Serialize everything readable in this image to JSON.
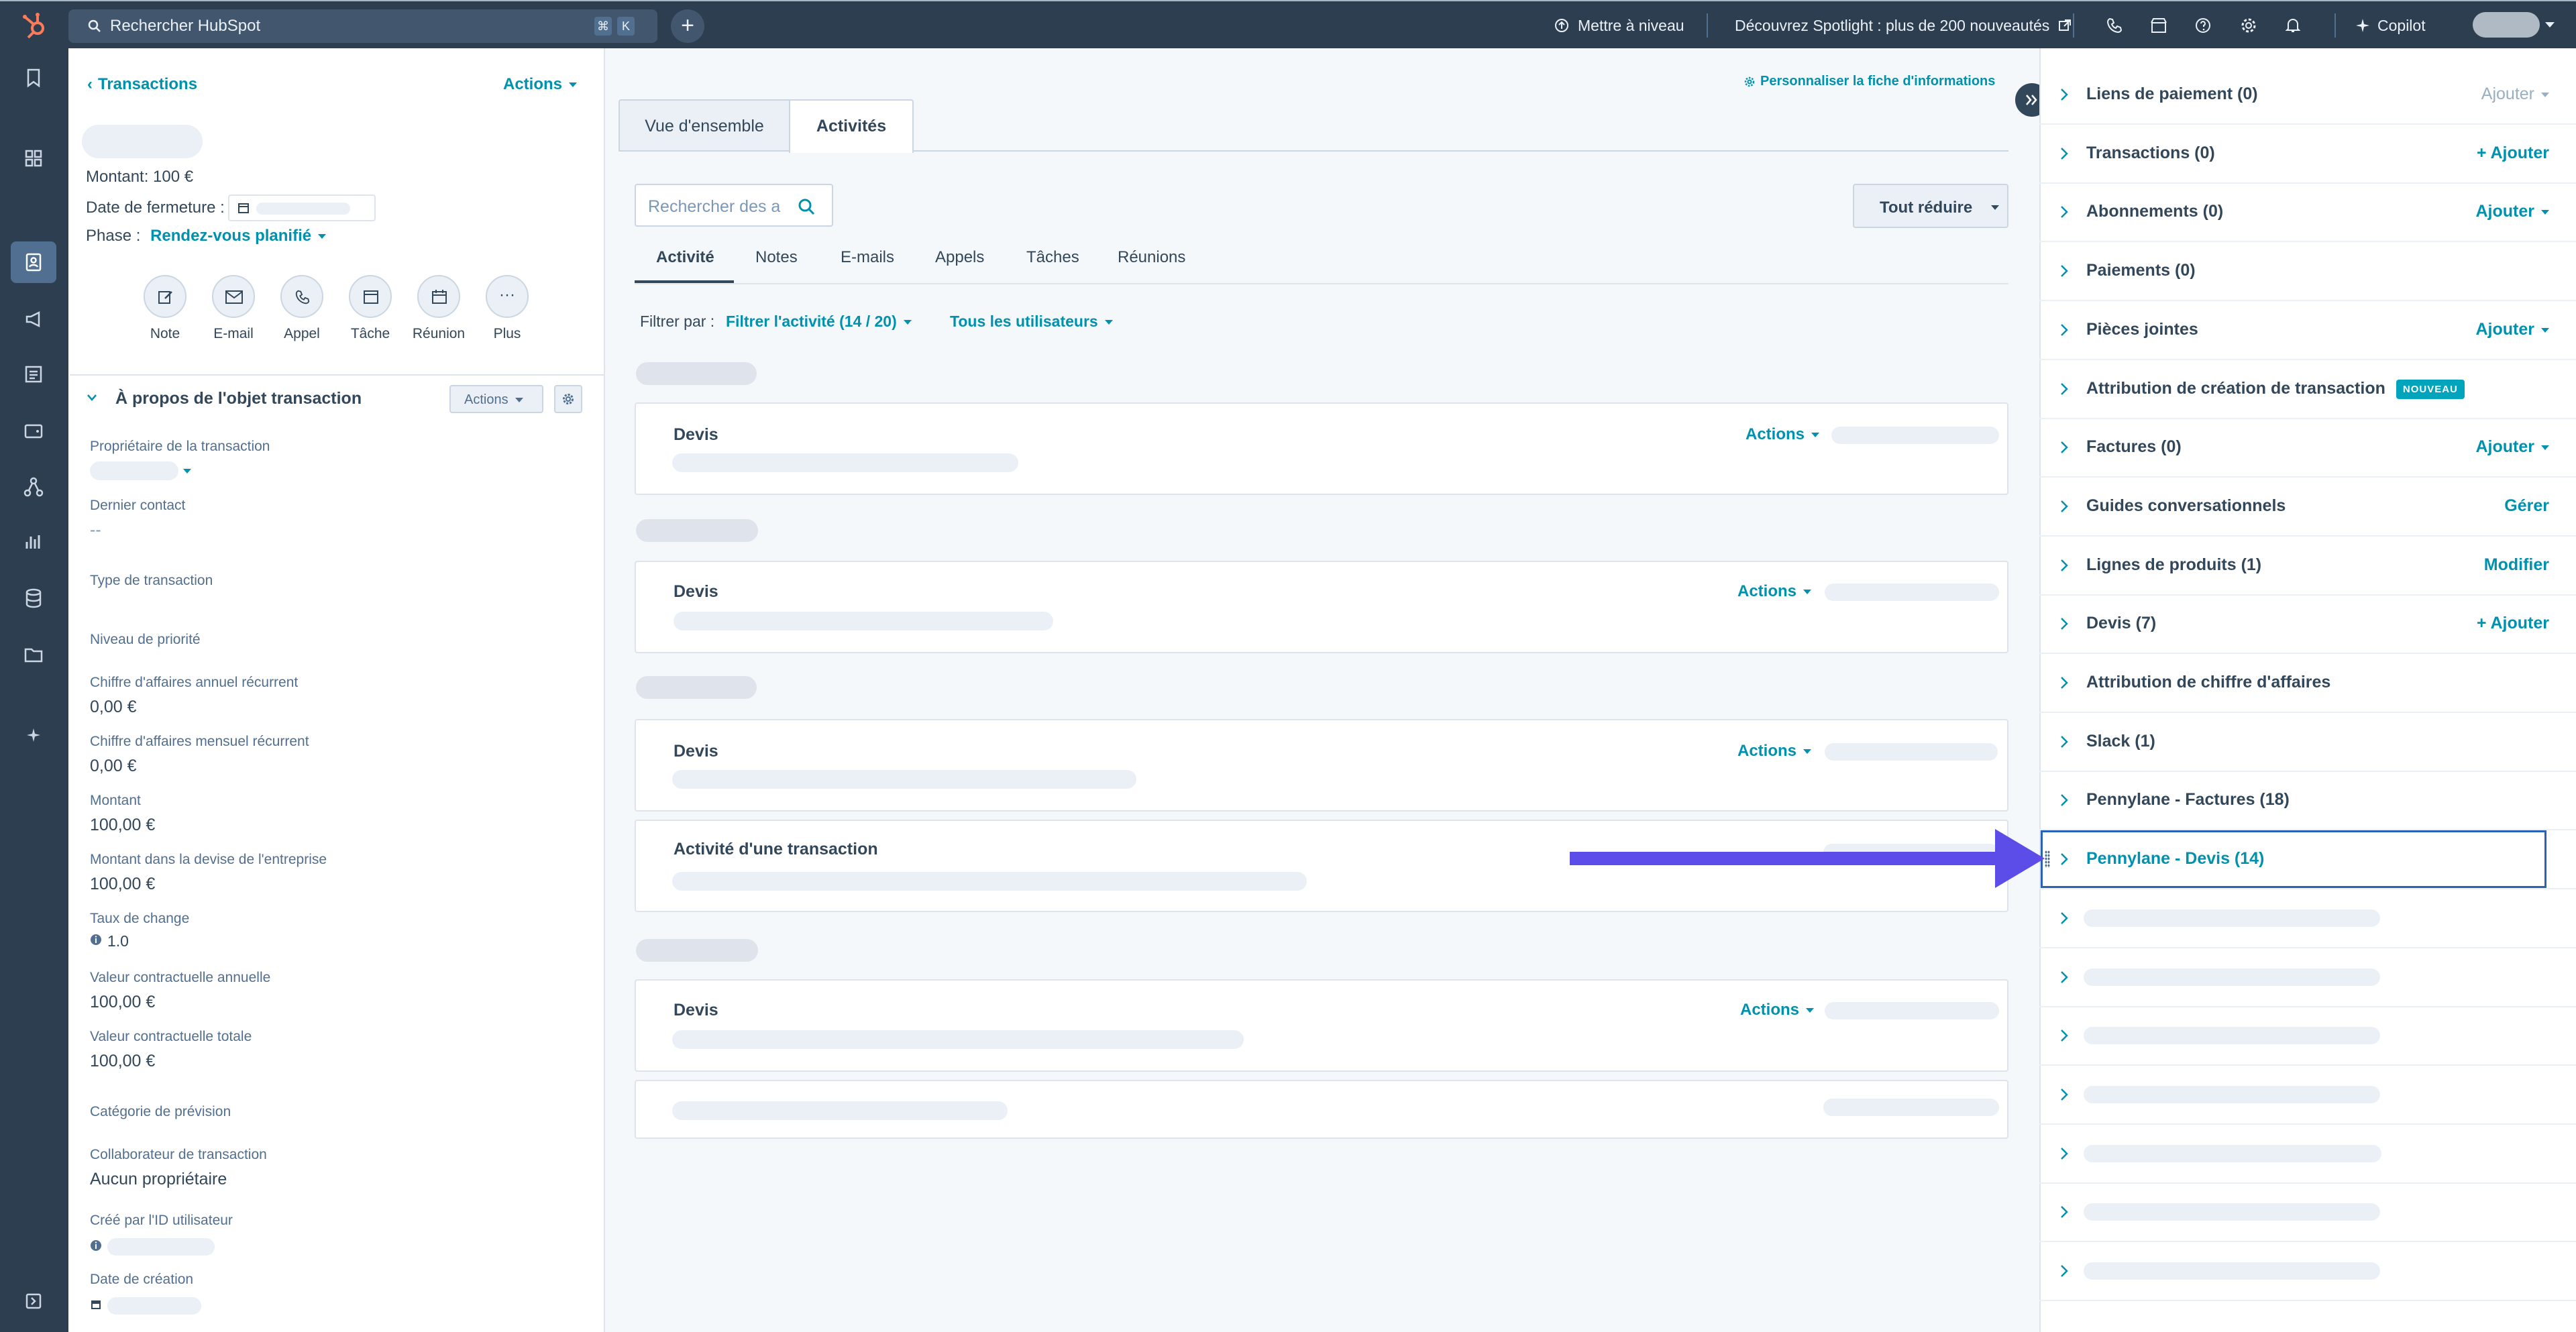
{
  "topbar": {
    "search_placeholder": "Rechercher HubSpot",
    "kbd_cmd": "⌘",
    "kbd_k": "K",
    "upgrade": "Mettre à niveau",
    "spotlight": "Découvrez Spotlight : plus de 200 nouveautés",
    "copilot": "Copilot"
  },
  "record": {
    "back_link": "Transactions",
    "actions": "Actions",
    "amount": "Montant: 100 €",
    "close_date_label": "Date de fermeture :",
    "phase_label": "Phase :",
    "phase_value": "Rendez-vous planifié",
    "activity_buttons": [
      "Note",
      "E-mail",
      "Appel",
      "Tâche",
      "Réunion",
      "Plus"
    ],
    "about_title": "À propos de l'objet transaction",
    "about_actions": "Actions",
    "properties": [
      {
        "label": "Propriétaire de la transaction",
        "value": ""
      },
      {
        "label": "Dernier contact",
        "value": "--"
      },
      {
        "label": "Type de transaction",
        "value": ""
      },
      {
        "label": "Niveau de priorité",
        "value": ""
      },
      {
        "label": "Chiffre d'affaires annuel récurrent",
        "value": "0,00 €"
      },
      {
        "label": "Chiffre d'affaires mensuel récurrent",
        "value": "0,00 €"
      },
      {
        "label": "Montant",
        "value": "100,00 €"
      },
      {
        "label": "Montant dans la devise de l'entreprise",
        "value": "100,00 €"
      },
      {
        "label": "Taux de change",
        "value": "1.0"
      },
      {
        "label": "Valeur contractuelle annuelle",
        "value": "100,00 €"
      },
      {
        "label": "Valeur contractuelle totale",
        "value": "100,00 €"
      },
      {
        "label": "Catégorie de prévision",
        "value": ""
      },
      {
        "label": "Collaborateur de transaction",
        "value": "Aucun propriétaire"
      },
      {
        "label": "Créé par l'ID utilisateur",
        "value": ""
      },
      {
        "label": "Date de création",
        "value": ""
      }
    ]
  },
  "middle": {
    "customize_link": "Personnaliser la fiche d'informations",
    "tabs": [
      "Vue d'ensemble",
      "Activités"
    ],
    "search_placeholder": "Rechercher des a",
    "collapse_all": "Tout réduire",
    "subtabs": [
      "Activité",
      "Notes",
      "E-mails",
      "Appels",
      "Tâches",
      "Réunions"
    ],
    "filter_label": "Filtrer par :",
    "filter_activity": "Filtrer l'activité (14 / 20)",
    "filter_users": "Tous les utilisateurs",
    "cards": [
      {
        "title": "Devis",
        "actions": "Actions"
      },
      {
        "title": "Devis",
        "actions": "Actions"
      },
      {
        "title": "Devis",
        "actions": "Actions"
      },
      {
        "title": "Activité d'une transaction",
        "actions": ""
      },
      {
        "title": "Devis",
        "actions": "Actions"
      }
    ]
  },
  "sidebar": {
    "sections": [
      {
        "title": "Liens de paiement (0)",
        "action": "Ajouter",
        "muted": true
      },
      {
        "title": "Transactions (0)",
        "action": "+ Ajouter",
        "muted": false
      },
      {
        "title": "Abonnements (0)",
        "action": "Ajouter",
        "muted": false
      },
      {
        "title": "Paiements (0)",
        "action": "",
        "muted": false
      },
      {
        "title": "Pièces jointes",
        "action": "Ajouter",
        "muted": false
      },
      {
        "title": "Attribution de création de transaction",
        "action": "",
        "muted": false,
        "badge": "NOUVEAU"
      },
      {
        "title": "Factures (0)",
        "action": "Ajouter",
        "muted": false
      },
      {
        "title": "Guides conversationnels",
        "action": "Gérer",
        "muted": false
      },
      {
        "title": "Lignes de produits (1)",
        "action": "Modifier",
        "muted": false
      },
      {
        "title": "Devis (7)",
        "action": "+ Ajouter",
        "muted": false
      },
      {
        "title": "Attribution de chiffre d'affaires",
        "action": "",
        "muted": false
      },
      {
        "title": "Slack (1)",
        "action": "",
        "muted": false
      },
      {
        "title": "Pennylane - Factures (18)",
        "action": "",
        "muted": false
      },
      {
        "title": "Pennylane - Devis (14)",
        "action": "",
        "muted": false,
        "highlight": true
      }
    ]
  },
  "colors": {
    "nav_bg": "#2d3e50",
    "link": "#0091ae",
    "arrow": "#5c4de8",
    "badge": "#00a4bd"
  }
}
